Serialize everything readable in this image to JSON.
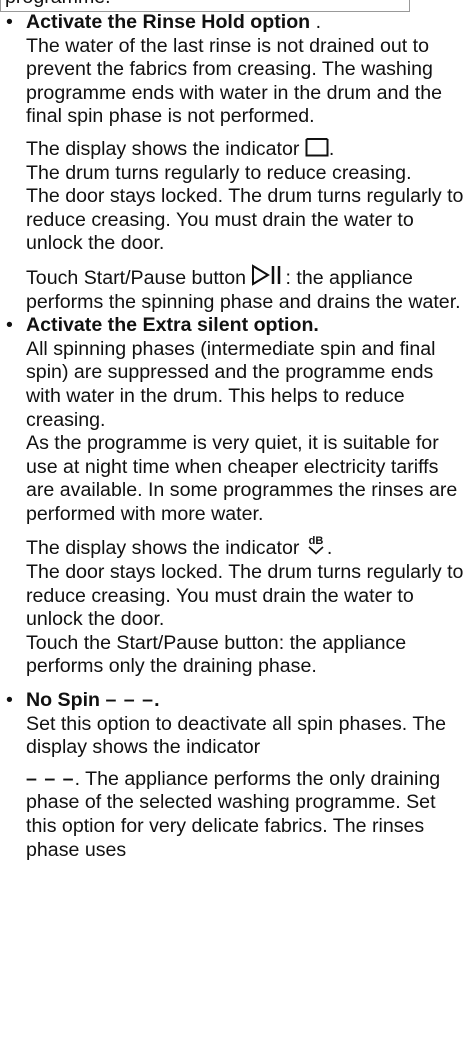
{
  "header": {
    "text": "programme."
  },
  "items": [
    {
      "title": "Activate the Rinse Hold option",
      "title_suffix": " .",
      "p1": "The water of the last rinse is not drained out to prevent the fabrics from creasing. The washing programme ends with water in the drum and the final spin phase is not performed.",
      "p2a": "The display shows the indicator ",
      "p2b": ".",
      "p2c": "The drum turns regularly to reduce creasing.",
      "p2d": "The door stays locked. The drum turns regularly to reduce creasing. You must drain the water to unlock the door.",
      "p3a": "Touch Start/Pause button ",
      "p3b": ": the appliance performs the spinning phase and drains the water."
    },
    {
      "title": "Activate the Extra silent option.",
      "p1": "All spinning phases (intermediate spin and final spin) are suppressed and the programme ends with water in the drum. This helps to reduce creasing.",
      "p1b": "As the programme is very quiet, it is suitable for use at night time when cheaper electricity tariffs are available. In some programmes the rinses are performed with more water.",
      "p2a": "The display shows the indicator ",
      "p2b": ".",
      "p2c": "The door stays locked. The drum turns regularly to reduce creasing. You must drain the water to unlock the door.",
      "p2d": "Touch the Start/Pause button: the appliance performs only the draining phase.",
      "icon_label": "dB"
    },
    {
      "title": "No Spin",
      "title_dash": "– – –",
      "title_suffix": ".",
      "p1": "Set this option to deactivate all spin phases. The display shows the indicator",
      "p2_dash": "– – –",
      "p2": ". The appliance performs the only draining phase of the selected washing programme. Set this option for very delicate fabrics. The rinses phase uses"
    }
  ]
}
